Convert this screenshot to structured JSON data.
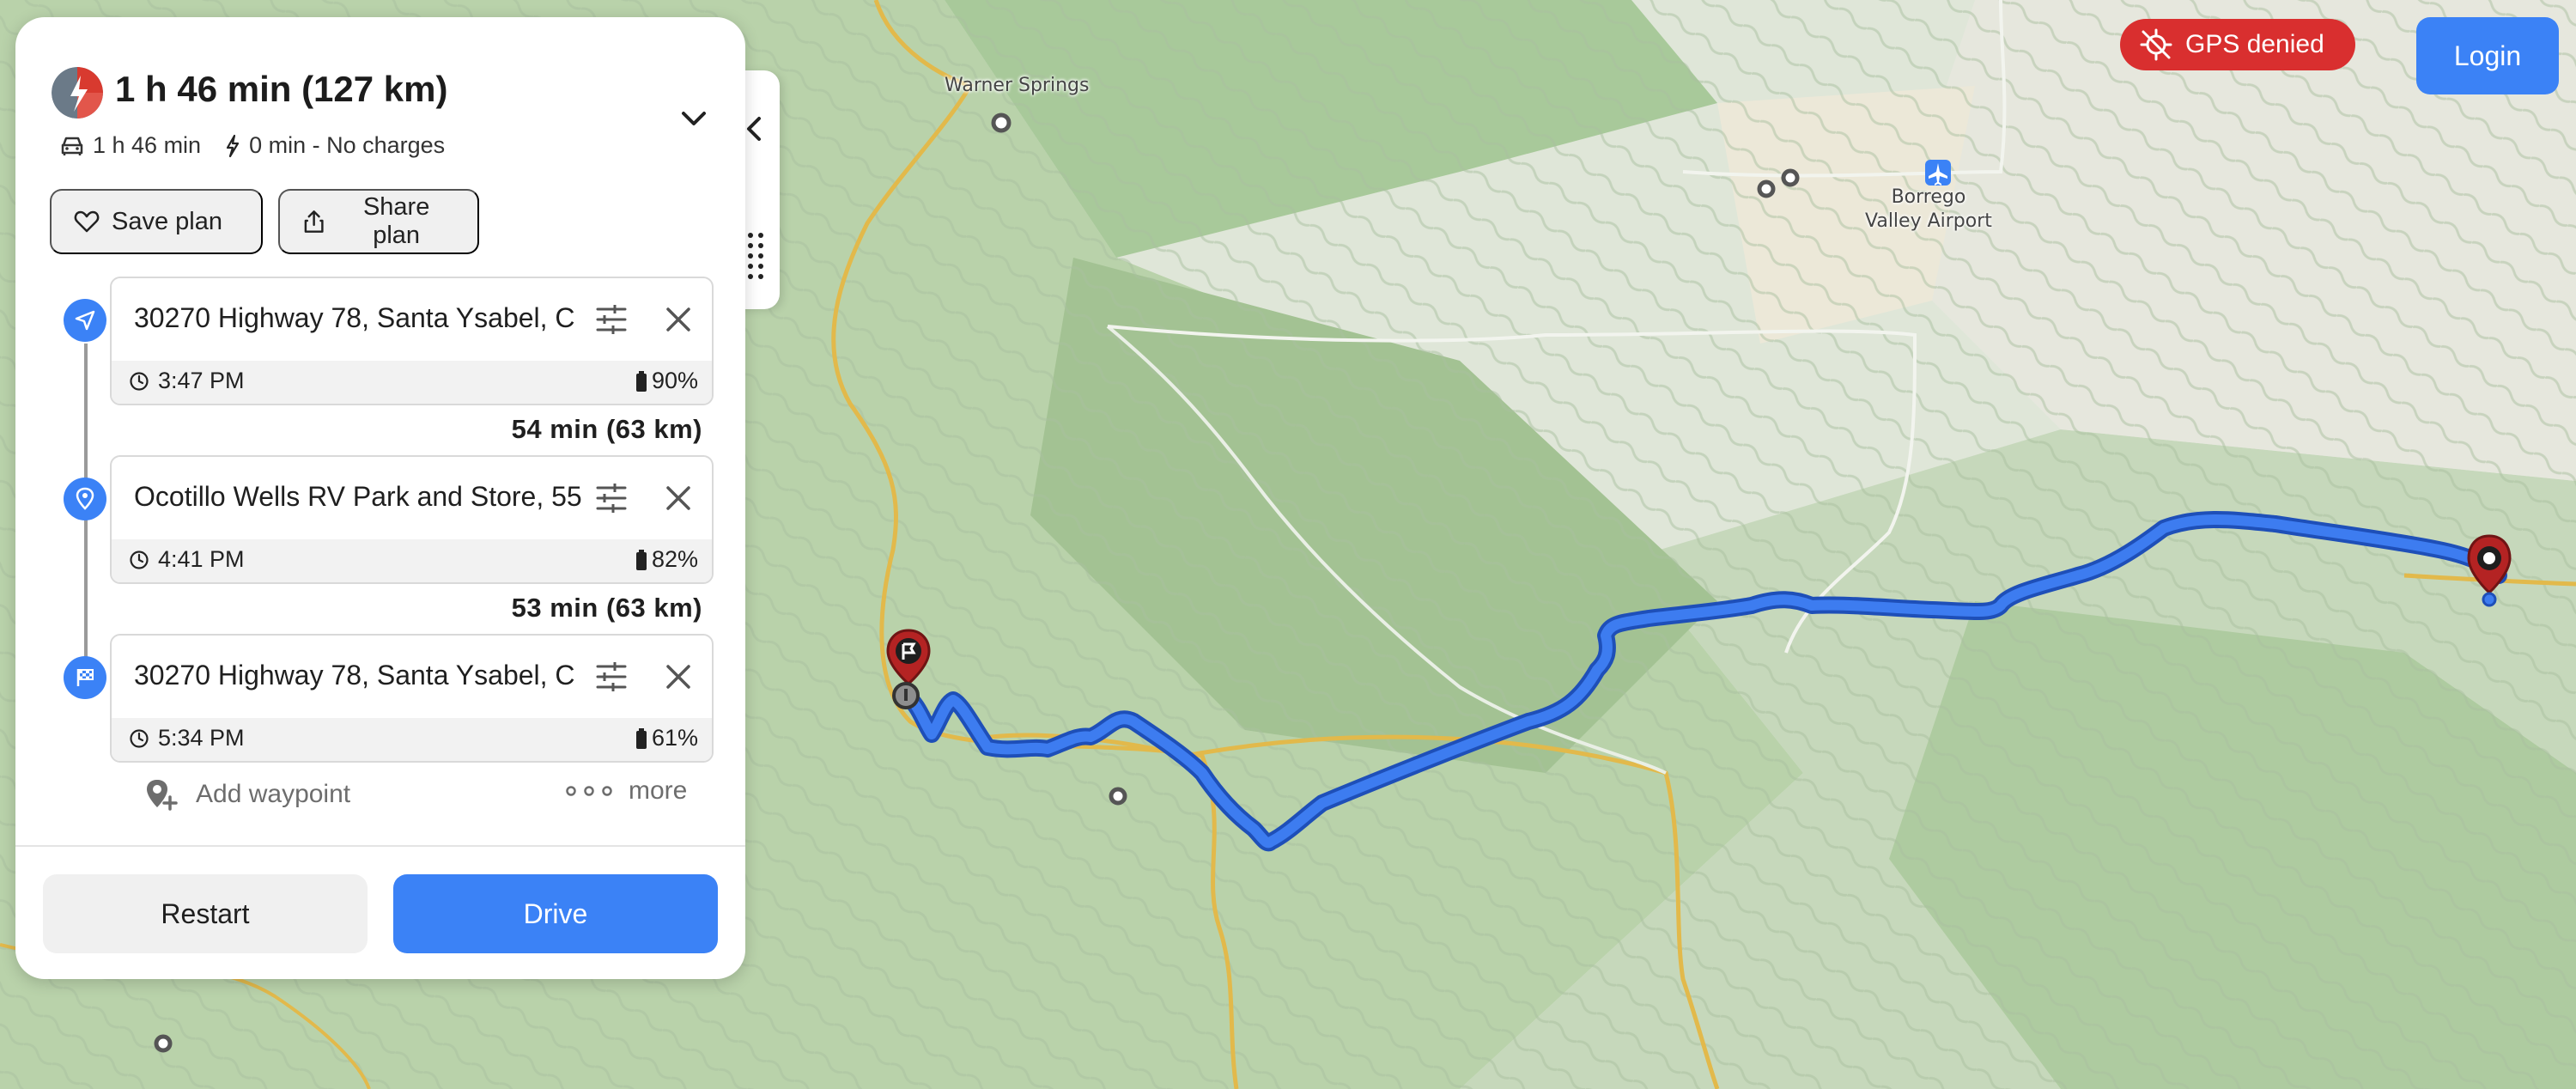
{
  "summary": {
    "title": "1 h 46 min (127 km)",
    "drive_time": "1 h 46 min",
    "charge_info": "0 min - No charges"
  },
  "actions": {
    "save_plan": "Save plan",
    "share_plan": "Share plan"
  },
  "stops": [
    {
      "address": "30270 Highway 78, Santa Ysabel, C",
      "time": "3:47 PM",
      "battery": "90%"
    },
    {
      "address": "Ocotillo Wells RV Park and Store, 55",
      "time": "4:41 PM",
      "battery": "82%"
    },
    {
      "address": "30270 Highway 78, Santa Ysabel, C",
      "time": "5:34 PM",
      "battery": "61%"
    }
  ],
  "legs": [
    "54 min (63 km)",
    "53 min (63 km)"
  ],
  "add_waypoint": "Add waypoint",
  "more": "more",
  "buttons": {
    "restart": "Restart",
    "drive": "Drive"
  },
  "status": {
    "gps": "GPS denied"
  },
  "login": "Login",
  "map_labels": {
    "warner_springs": "Warner Springs",
    "borrego_airport": "Borrego\nValley Airport"
  },
  "colors": {
    "accent": "#3b82f6",
    "route": "#3d7cf0",
    "alert": "#d92f2f",
    "marker": "#b42323"
  }
}
